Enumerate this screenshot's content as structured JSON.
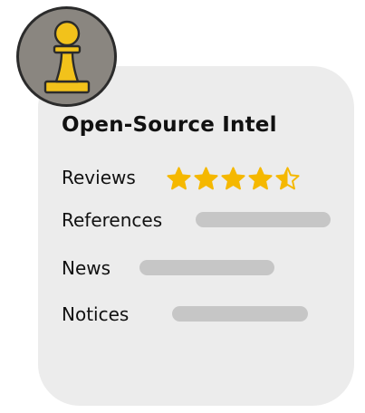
{
  "card": {
    "title": "Open-Source Intel",
    "icon": "chess-pawn-icon",
    "rows": [
      {
        "label": "Reviews",
        "rating": 4.5,
        "rating_max": 5
      },
      {
        "label": "References"
      },
      {
        "label": "News"
      },
      {
        "label": "Notices"
      }
    ]
  },
  "colors": {
    "card_bg": "#ececec",
    "badge_bg": "#8a8680",
    "pawn": "#f2c21b",
    "star": "#f5b800",
    "bar": "#c6c6c6"
  }
}
